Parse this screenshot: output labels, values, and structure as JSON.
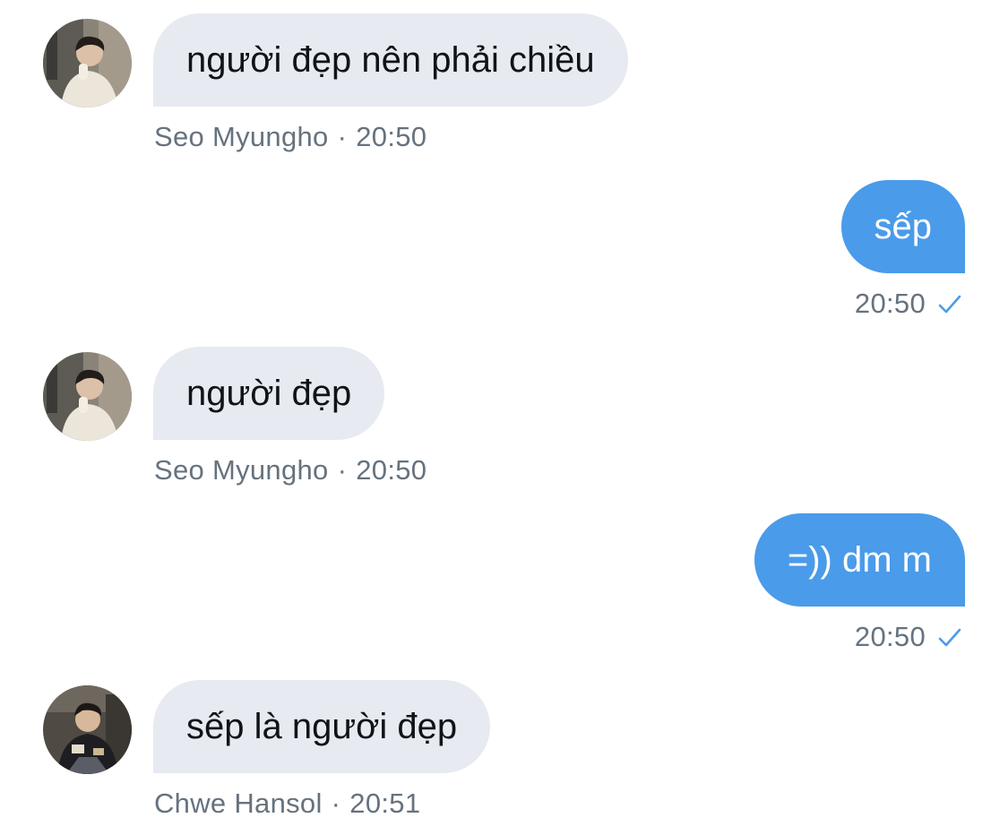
{
  "colors": {
    "incoming_bubble": "#e7eaf0",
    "outgoing_bubble": "#4a9be9",
    "meta_text": "#66727e",
    "sent_check": "#4a9be9"
  },
  "messages": [
    {
      "direction": "incoming",
      "text": "người đẹp nên phải chiều",
      "sender": "Seo Myungho",
      "separator": "·",
      "time": "20:50",
      "avatar_icon": "user-avatar-photo"
    },
    {
      "direction": "outgoing",
      "text": "sếp",
      "time": "20:50",
      "status_icon": "sent-check-icon"
    },
    {
      "direction": "incoming",
      "text": "người đẹp",
      "sender": "Seo Myungho",
      "separator": "·",
      "time": "20:50",
      "avatar_icon": "user-avatar-photo"
    },
    {
      "direction": "outgoing",
      "text": "=)) dm m",
      "time": "20:50",
      "status_icon": "sent-check-icon"
    },
    {
      "direction": "incoming",
      "text": "sếp là người đẹp",
      "sender": "Chwe Hansol",
      "separator": "·",
      "time": "20:51",
      "avatar_icon": "user-avatar-photo"
    }
  ]
}
